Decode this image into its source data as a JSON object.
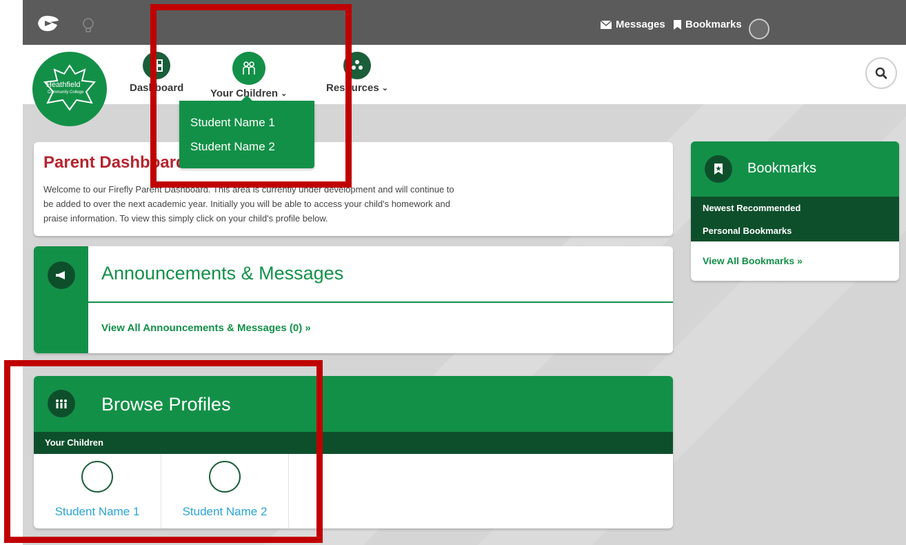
{
  "colors": {
    "brand_green": "#139048",
    "dark_green": "#0e4f2b",
    "top_bar": "#5b5b5b",
    "title_red": "#b5252f",
    "link_blue": "#2aa3d8",
    "annotation_red": "#c00000"
  },
  "topbar": {
    "messages_label": "Messages",
    "bookmarks_label": "Bookmarks"
  },
  "school": {
    "name": "Heathfield",
    "subtitle": "Community College"
  },
  "nav": {
    "dashboard_label": "Dashboard",
    "children_label": "Your Children",
    "resources_label": "Resources"
  },
  "dropdown": {
    "items": [
      "Student Name 1",
      "Student Name 2"
    ]
  },
  "welcome": {
    "title": "Parent Dashboard",
    "text": "Welcome to our Firefly Parent Dashboard. This area is currently under development and will continue to be added to over the next academic year. Initially you will be able to access your child's homework and praise information. To view this simply click on your child's profile below."
  },
  "announcements": {
    "title": "Announcements & Messages",
    "link": "View All Announcements & Messages (0) »"
  },
  "profiles": {
    "title": "Browse Profiles",
    "section": "Your Children",
    "children": [
      "Student Name 1",
      "Student Name 2"
    ]
  },
  "bookmarks": {
    "title": "Bookmarks",
    "tabs": [
      "Newest Recommended",
      "Personal Bookmarks"
    ],
    "link": "View All Bookmarks »"
  }
}
